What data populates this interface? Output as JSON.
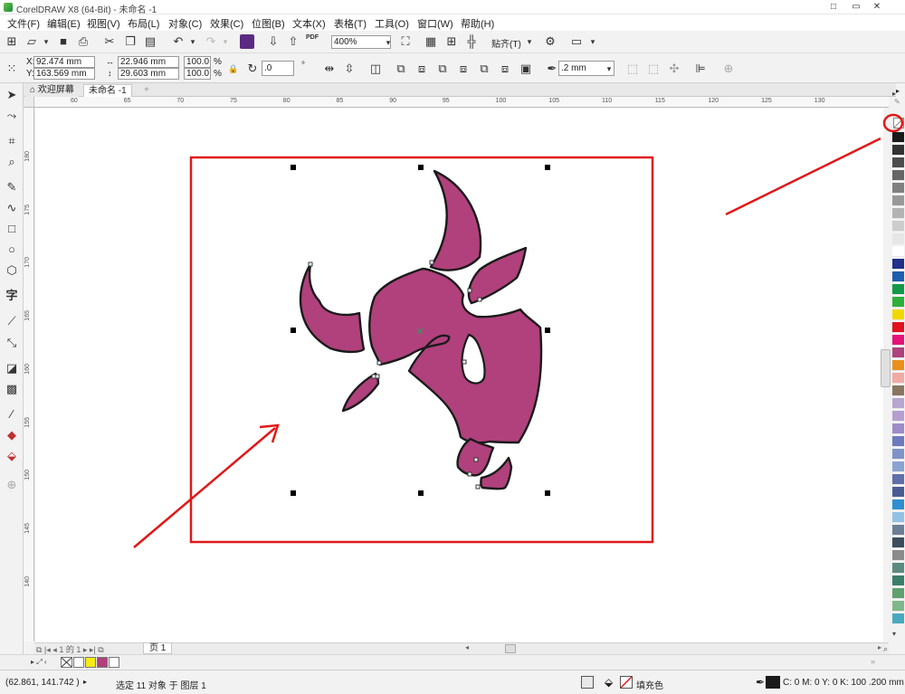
{
  "window": {
    "title": "CorelDRAW X8 (64-Bit) - 未命名 -1",
    "controls": [
      "□",
      "▭",
      "✕"
    ]
  },
  "menu": [
    "文件(F)",
    "编辑(E)",
    "视图(V)",
    "布局(L)",
    "对象(C)",
    "效果(C)",
    "位图(B)",
    "文本(X)",
    "表格(T)",
    "工具(O)",
    "窗口(W)",
    "帮助(H)"
  ],
  "standard_toolbar": {
    "zoom": "400%",
    "snap_label": "贴齐(T)",
    "pdf_label": "PDF"
  },
  "property_bar": {
    "x": "92.474 mm",
    "y": "163.569 mm",
    "width": "22.946 mm",
    "height": "29.603 mm",
    "scale_x": "100.0",
    "scale_y": "100.0",
    "percent": "%",
    "rotation": ".0",
    "outline_width": ".2 mm"
  },
  "tabs": {
    "welcome": "欢迎屏幕",
    "document": "未命名 -1",
    "add": "+"
  },
  "ruler": {
    "h_ticks": [
      "60",
      "65",
      "70",
      "75",
      "80",
      "85",
      "90",
      "95",
      "100",
      "105",
      "110",
      "115",
      "120",
      "125",
      "130"
    ],
    "v_ticks": [
      "180",
      "175",
      "170",
      "165",
      "160",
      "155",
      "150",
      "145",
      "140"
    ]
  },
  "page_nav": {
    "page_count": "1 的 1",
    "page_tab": "页 1"
  },
  "status": {
    "coords": "(62.861, 141.742 )",
    "selection": "选定 11 对象 于 图层 1",
    "fill_label": "填充色",
    "outline_info": "C: 0 M: 0 Y: 0 K: 100  .200 mm"
  },
  "colors": {
    "fill": "#b0417c",
    "outline": "#1a1a1a",
    "annotation": "#e01818"
  },
  "palette": [
    "#ffffff",
    "#1a1a1a",
    "#333333",
    "#4d4d4d",
    "#666666",
    "#808080",
    "#999999",
    "#b3b3b3",
    "#cccccc",
    "#e6e6e6",
    "#ffffff",
    "#1f2f8a",
    "#1d5fae",
    "#14994a",
    "#2fae3b",
    "#f0d800",
    "#e0121d",
    "#e5127a",
    "#b0417c",
    "#e8901a",
    "#f1aaa5",
    "#8a7560",
    "#b7a6cf",
    "#b49fd0",
    "#9b8cc7",
    "#6b7bbd",
    "#7e94c7",
    "#8aa3d2",
    "#5f6fa8",
    "#4b5c93",
    "#2f8fd2",
    "#93c1e6",
    "#6a7f96",
    "#3b4d5e",
    "#8b8b8b",
    "#5c8a80",
    "#3a7e6c",
    "#5fa16f",
    "#7fb88a",
    "#4aa8c0"
  ],
  "doc_palette": [
    "#ffffff",
    "#f7ec13",
    "#b0417c",
    "#ffffff"
  ]
}
